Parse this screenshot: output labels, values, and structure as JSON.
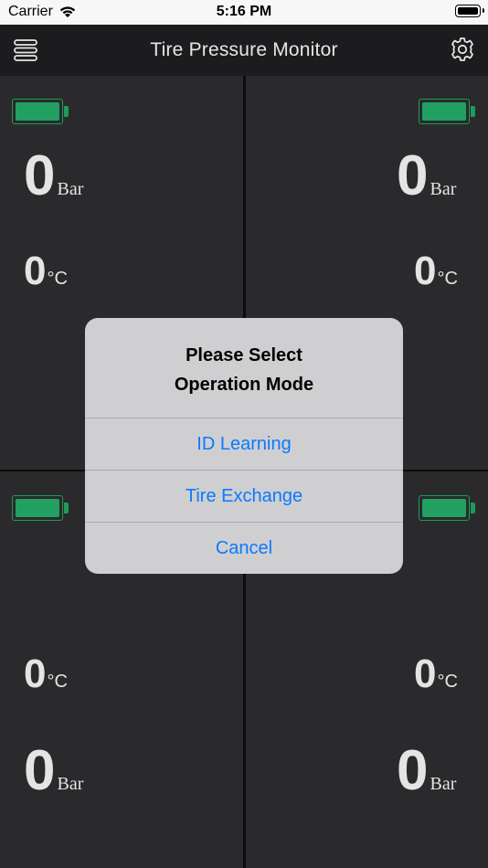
{
  "status_bar": {
    "carrier": "Carrier",
    "time": "5:16 PM"
  },
  "nav": {
    "title": "Tire Pressure Monitor"
  },
  "tires": {
    "front_left": {
      "pressure": "0",
      "pressure_unit": "Bar",
      "temperature": "0",
      "temp_unit": "°C",
      "battery_level": 1.0
    },
    "front_right": {
      "pressure": "0",
      "pressure_unit": "Bar",
      "temperature": "0",
      "temp_unit": "°C",
      "battery_level": 1.0
    },
    "rear_left": {
      "pressure": "0",
      "pressure_unit": "Bar",
      "temperature": "0",
      "temp_unit": "°C",
      "battery_level": 1.0
    },
    "rear_right": {
      "pressure": "0",
      "pressure_unit": "Bar",
      "temperature": "0",
      "temp_unit": "°C",
      "battery_level": 1.0
    }
  },
  "alert": {
    "title_line1": "Please Select",
    "title_line2": "Operation Mode",
    "options": [
      "ID Learning",
      "Tire Exchange",
      "Cancel"
    ]
  },
  "colors": {
    "battery": "#22a062",
    "link": "#0a7aff",
    "background": "#2a2a2c"
  }
}
